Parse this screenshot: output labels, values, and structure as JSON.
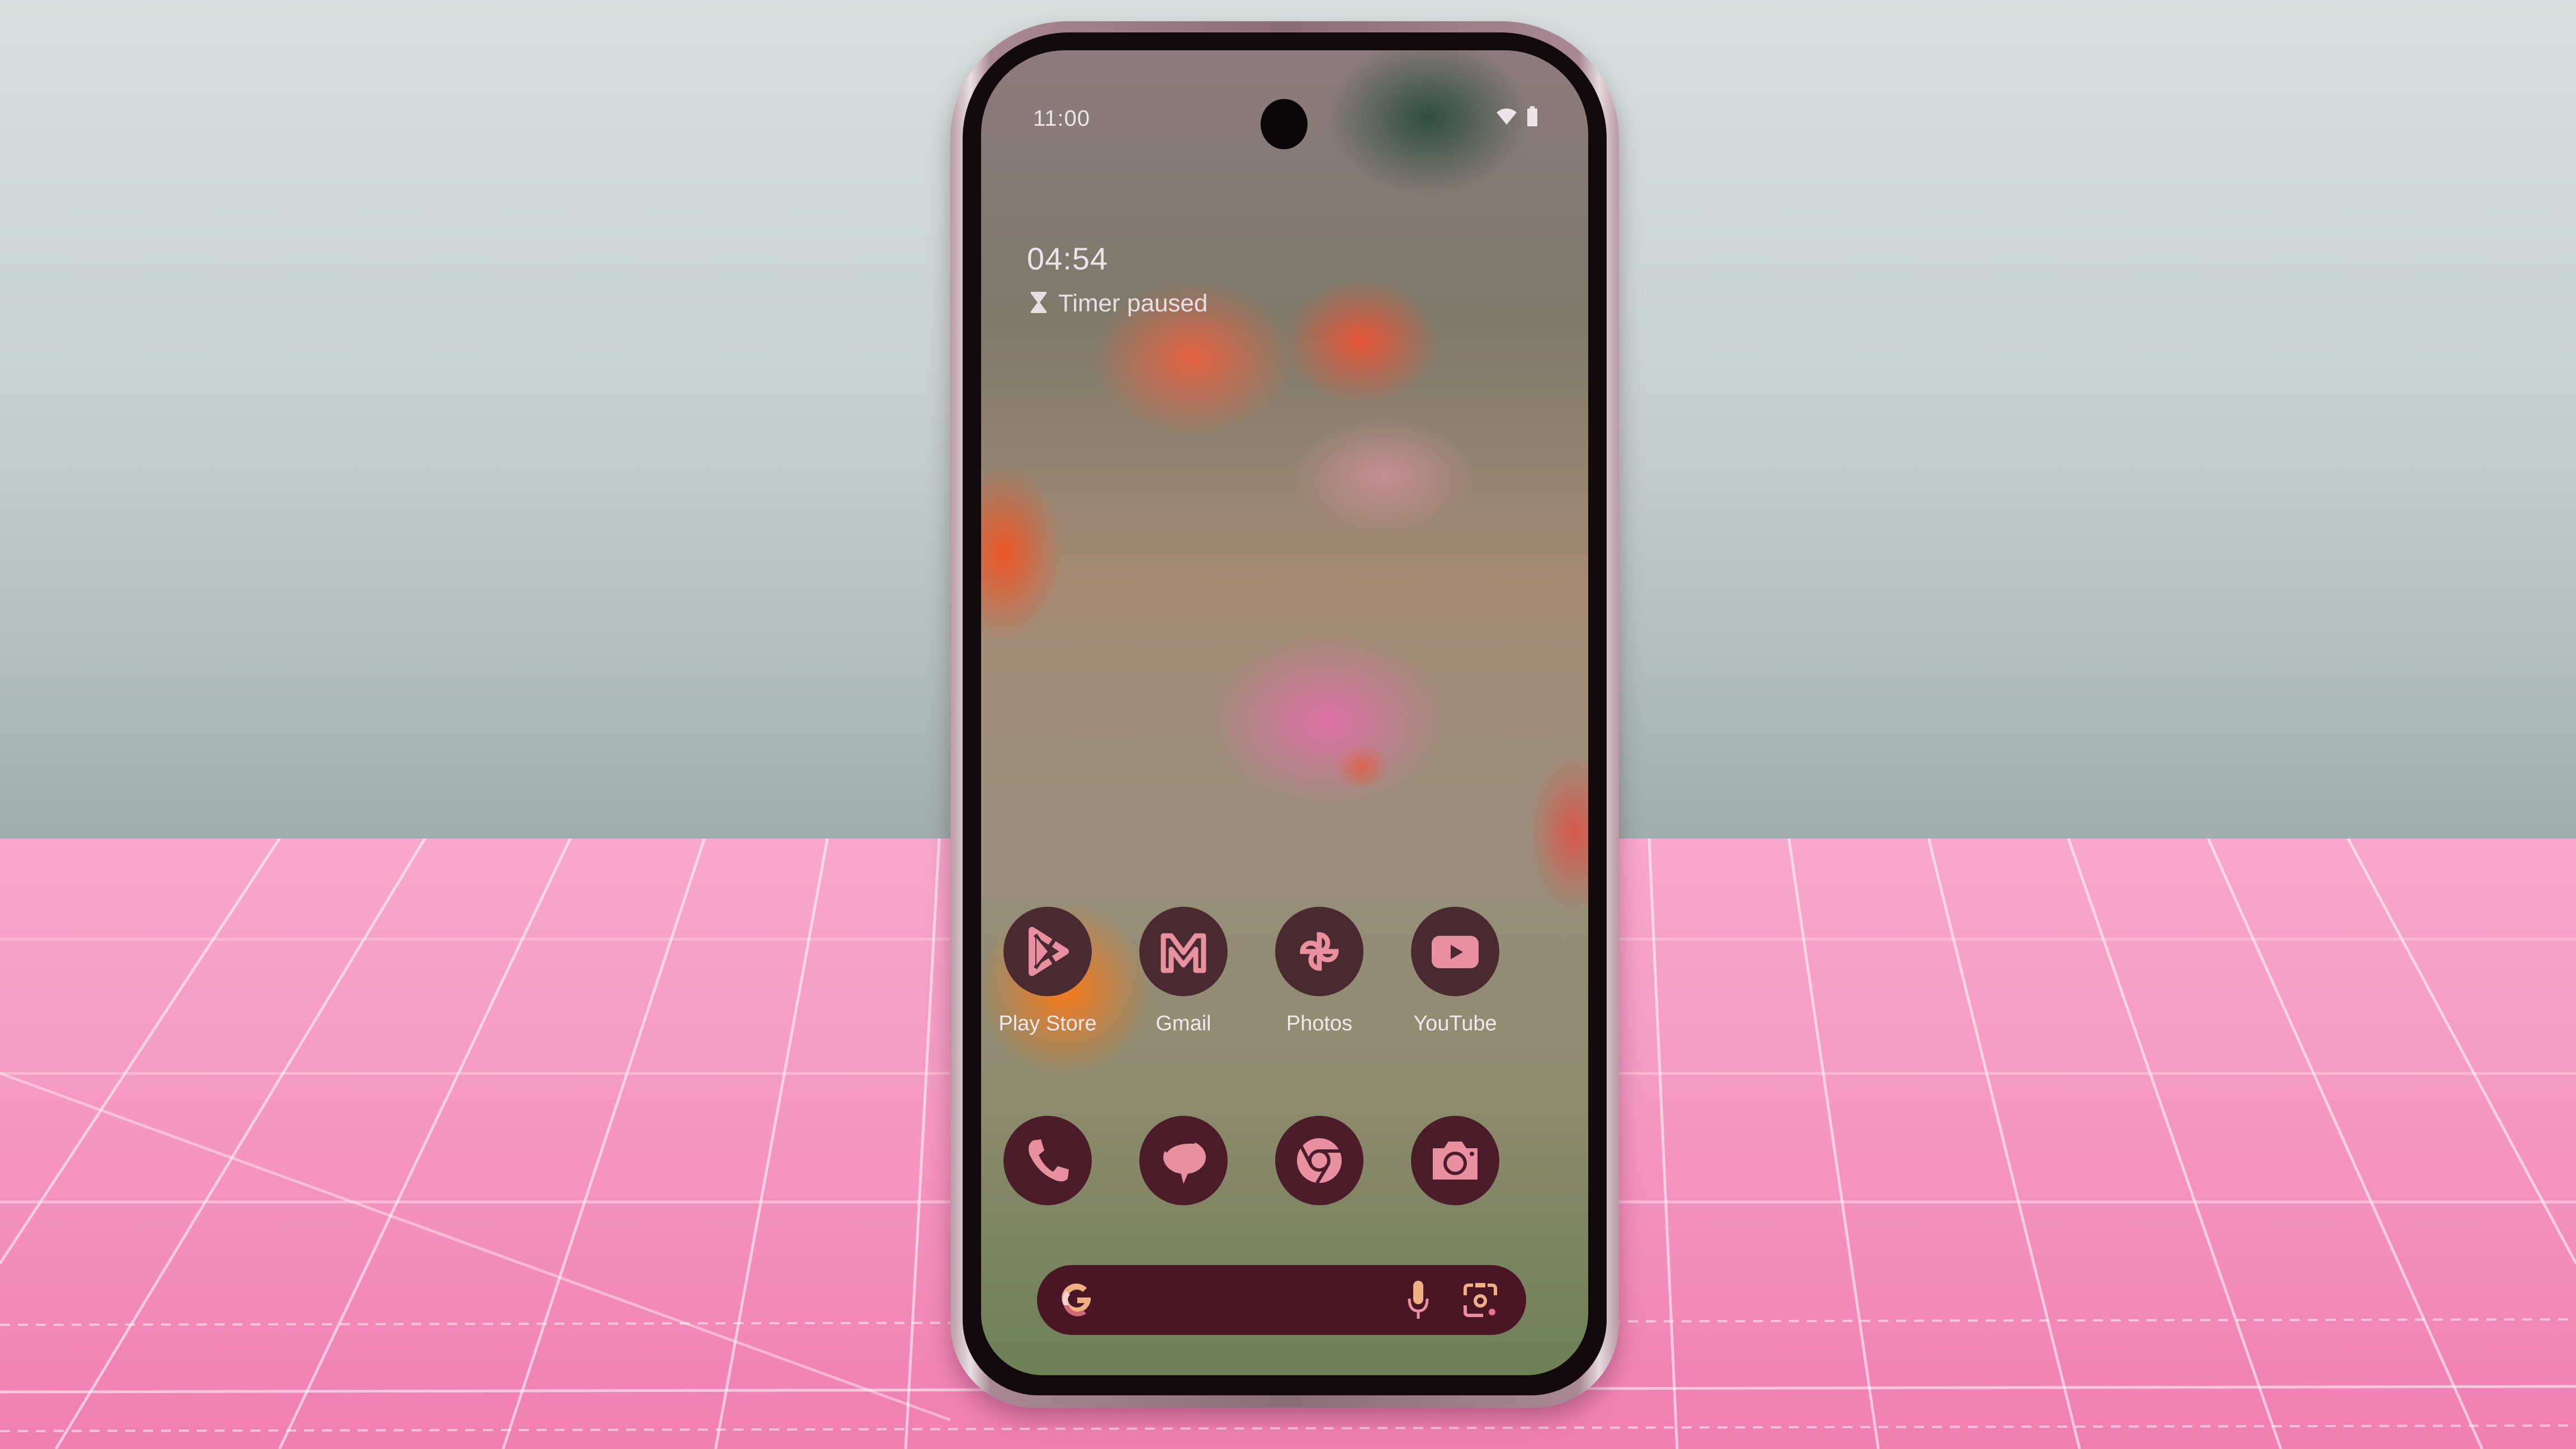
{
  "status_bar": {
    "time": "11:00",
    "icons": [
      "wifi-icon",
      "battery-icon"
    ]
  },
  "widget": {
    "timer_value": "04:54",
    "timer_status": "Timer paused",
    "timer_icon": "hourglass-icon"
  },
  "home_row": [
    {
      "label": "Play Store",
      "icon": "play-store-icon"
    },
    {
      "label": "Gmail",
      "icon": "gmail-icon"
    },
    {
      "label": "Photos",
      "icon": "photos-icon"
    },
    {
      "label": "YouTube",
      "icon": "youtube-icon"
    }
  ],
  "dock": [
    {
      "icon": "phone-icon"
    },
    {
      "icon": "messages-icon"
    },
    {
      "icon": "chrome-icon"
    },
    {
      "icon": "camera-icon"
    }
  ],
  "search_bar": {
    "icons": [
      "google-g-icon",
      "microphone-icon",
      "google-lens-icon"
    ]
  },
  "colors": {
    "icon_bg": "#4a2a31",
    "icon_glyph": "#e890a0",
    "search_bg": "#4a1525",
    "mat_pink": "#f59ac3"
  }
}
